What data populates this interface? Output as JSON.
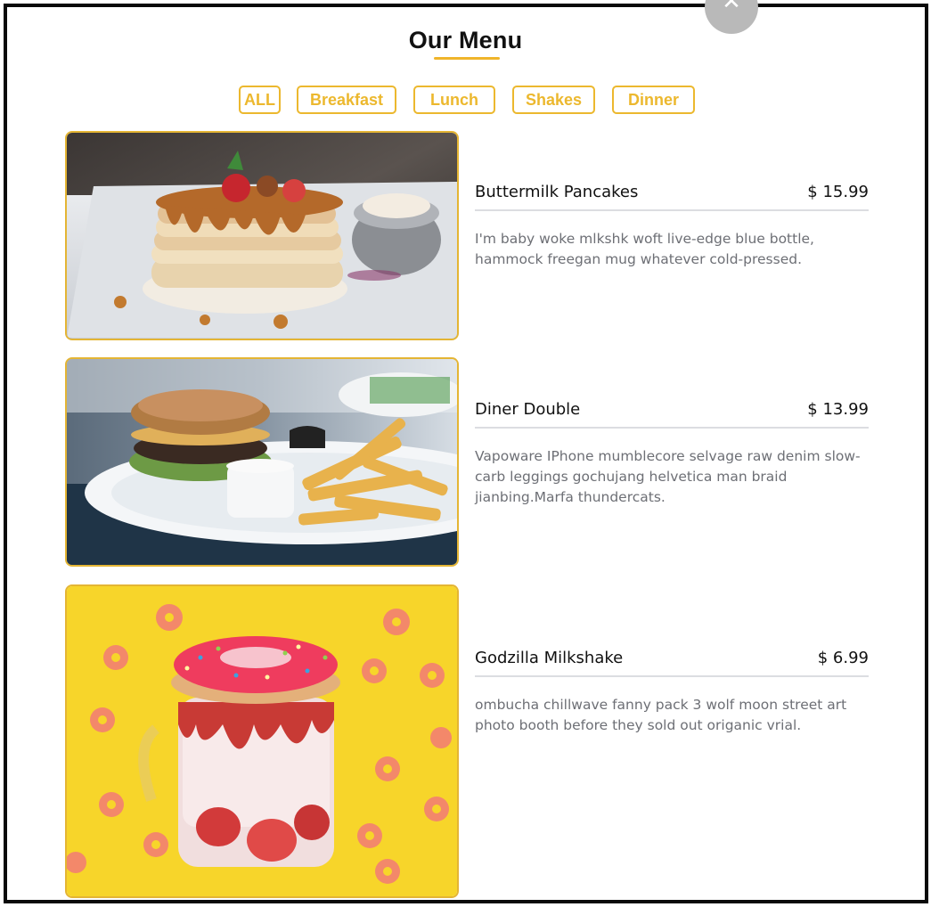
{
  "close_button": {
    "icon": "close-icon",
    "glyph": "✕"
  },
  "page": {
    "title": "Our Menu",
    "accent_color": "#ecb82e"
  },
  "filters": [
    {
      "label": "ALL"
    },
    {
      "label": "Breakfast"
    },
    {
      "label": "Lunch"
    },
    {
      "label": "Shakes"
    },
    {
      "label": "Dinner"
    }
  ],
  "menu": [
    {
      "name": "Buttermilk Pancakes",
      "price": "$ 15.99",
      "description": "I'm baby woke mlkshk woft live-edge blue bottle, hammock freegan mug whatever cold-pressed."
    },
    {
      "name": "Diner Double",
      "price": "$ 13.99",
      "description": "Vapoware IPhone mumblecore selvage raw denim slow-carb leggings gochujang helvetica man braid jianbing.Marfa thundercats."
    },
    {
      "name": "Godzilla Milkshake",
      "price": "$ 6.99",
      "description": "ombucha chillwave fanny pack 3 wolf moon street art photo booth before they sold out origanic vrial."
    }
  ]
}
